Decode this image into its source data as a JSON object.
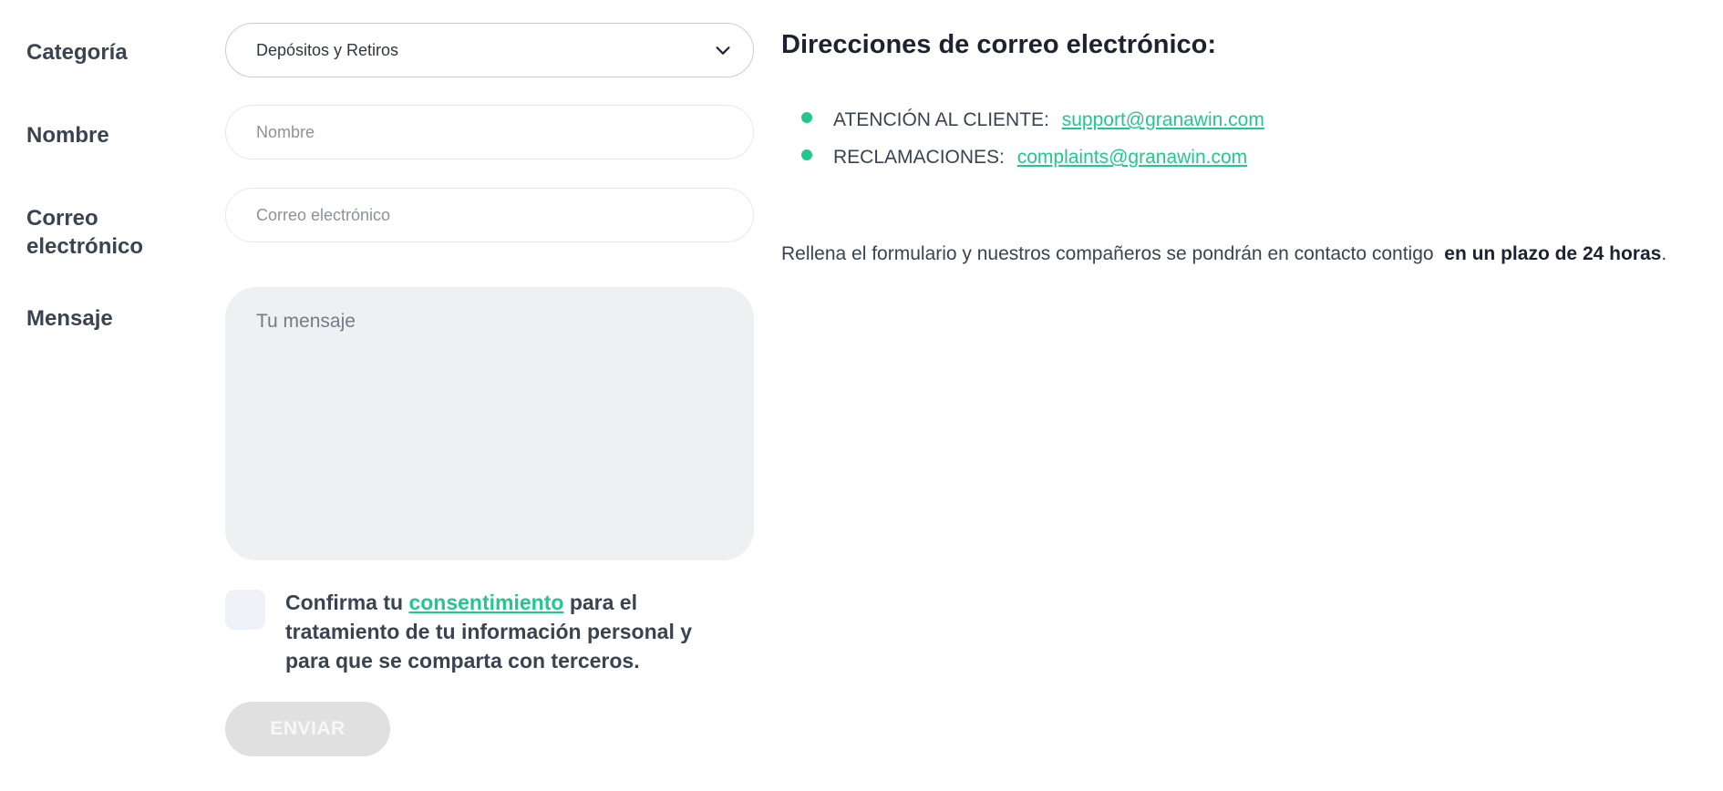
{
  "form": {
    "category": {
      "label": "Categoría",
      "value": "Depósitos y Retiros"
    },
    "name": {
      "label": "Nombre",
      "placeholder": "Nombre"
    },
    "email": {
      "label_line1": "Correo",
      "label_line2": "electrónico",
      "placeholder": "Correo electrónico"
    },
    "message": {
      "label": "Mensaje",
      "placeholder": "Tu mensaje"
    },
    "consent": {
      "text_before": "Confirma tu",
      "link": "consentimiento",
      "text_after": "para el tratamiento de tu información personal y para que se comparta con terceros."
    },
    "submit_label": "ENVIAR"
  },
  "contact": {
    "heading": "Direcciones de correo electrónico:",
    "items": [
      {
        "label": "ATENCIÓN AL CLIENTE:",
        "email": "support@granawin.com"
      },
      {
        "label": "RECLAMACIONES:",
        "email": "complaints@granawin.com"
      }
    ],
    "note_text": "Rellena el formulario y nuestros compañeros se pondrán en contacto contigo",
    "note_bold": "en un plazo de 24 horas",
    "note_end": "."
  },
  "colors": {
    "accent": "#22c88b",
    "text": "#3a4350",
    "input_bg": "#eef0f1"
  }
}
